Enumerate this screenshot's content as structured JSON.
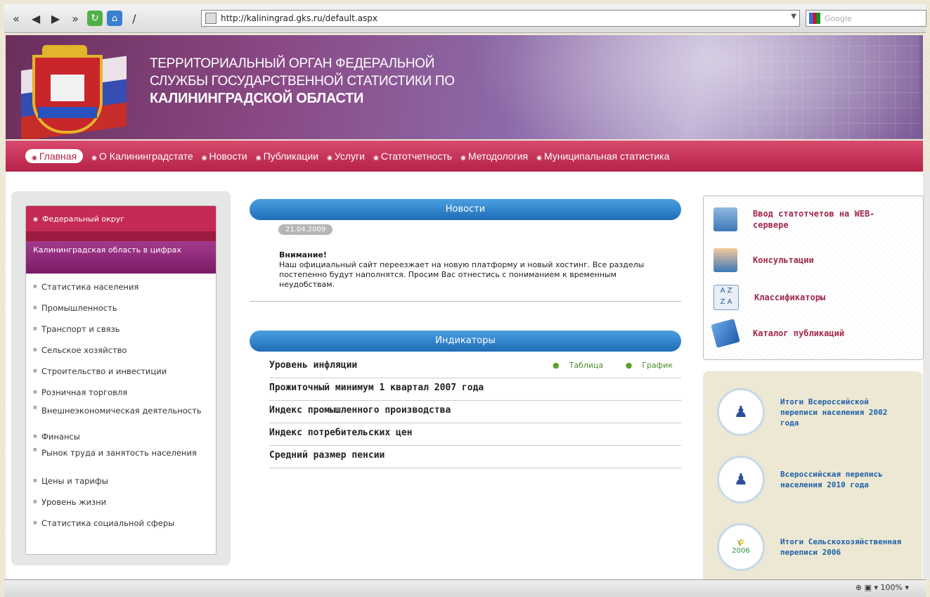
{
  "browser": {
    "url": "http://kaliningrad.gks.ru/default.aspx",
    "search_placeholder": "Google",
    "zoom": "100%"
  },
  "header": {
    "title_line1": "ТЕРРИТОРИАЛЬНЫЙ ОРГАН ФЕДЕРАЛЬНОЙ",
    "title_line2": "СЛУЖБЫ ГОСУДАРСТВЕННОЙ СТАТИСТИКИ ПО",
    "title_line3": "КАЛИНИНГРАДСКОЙ ОБЛАСТИ"
  },
  "nav": {
    "items": [
      "Главная",
      "О Калининградстате",
      "Новости",
      "Публикации",
      "Услуги",
      "Статотчетность",
      "Методология",
      "Муниципальная статистика"
    ]
  },
  "sidebar": {
    "federal": "Федеральный округ",
    "region": "Калининградская область в цифрах",
    "items": [
      "Статистика населения",
      "Промышленность",
      "Транспорт и связь",
      "Сельское хозяйство",
      "Строительство и инвестиции",
      "Розничная торговля",
      "Внешнеэкономическая деятельность",
      "Финансы",
      "Рынок труда и занятость населения",
      "Цены и тарифы",
      "Уровень жизни",
      "Статистика социальной сферы"
    ]
  },
  "news": {
    "heading": "Новости",
    "date": "21.04.2009",
    "attention": "Внимание!",
    "text": "Наш официальный сайт переезжает на новую платформу и новый хостинг. Все разделы постепенно будут наполнятся. Просим Вас отнестись с пониманием к временным неудобствам."
  },
  "indicators": {
    "heading": "Индикаторы",
    "table_label": "Таблица",
    "chart_label": "График",
    "rows": [
      "Уровень инфляции",
      "Прожиточный минимум 1 квартал 2007 года",
      "Индекс промышленного производства",
      "Индекс потребительских цен",
      "Средний размер пенсии"
    ]
  },
  "right_links": [
    "Ввод статотчетов на WEB-сервере",
    "Консультации",
    "Классификаторы",
    "Каталог публикаций"
  ],
  "census": [
    {
      "text": "Итоги Всероссийской переписи населения 2002 года"
    },
    {
      "text": "Всероссийская перепись населения 2010 года"
    },
    {
      "text": "Итоги Сельскохозяйственная переписи 2006",
      "year": "2006"
    }
  ]
}
